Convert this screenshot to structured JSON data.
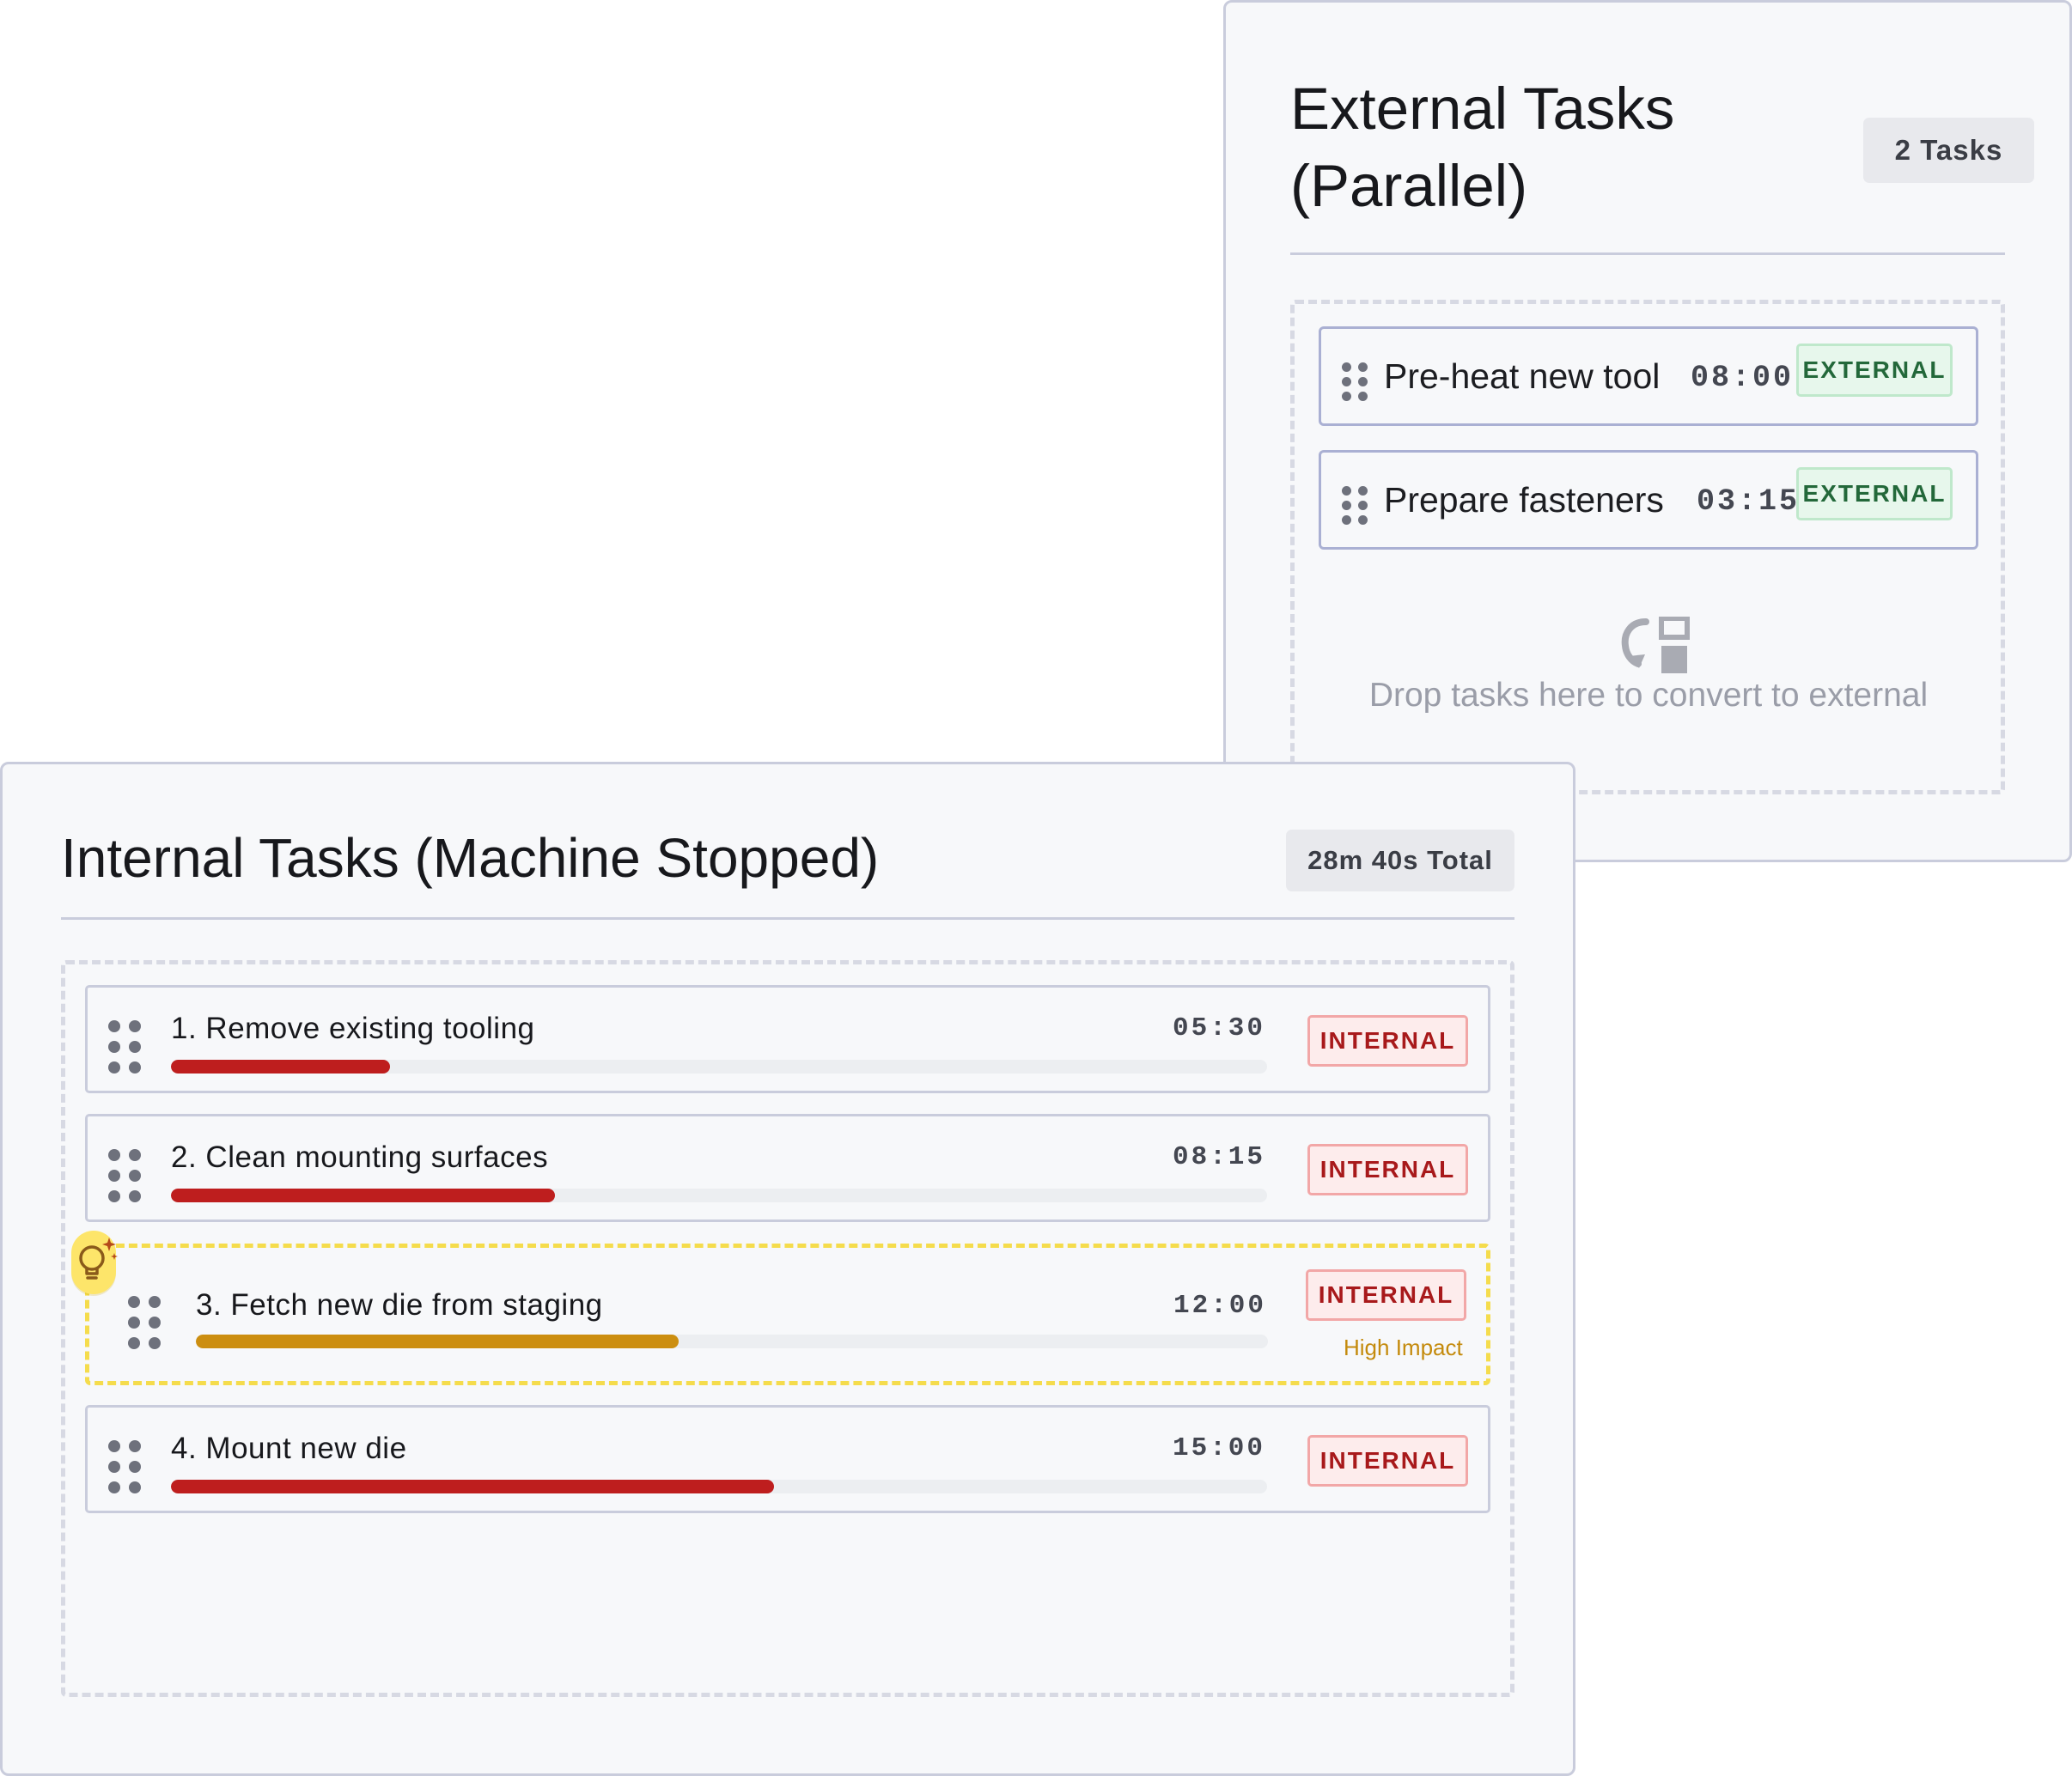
{
  "external": {
    "title_line1": "External Tasks",
    "title_line2": "(Parallel)",
    "count": "2 Tasks",
    "tasks": [
      {
        "title": "Pre-heat new tool",
        "time": "08:00",
        "tag": "EXTERNAL"
      },
      {
        "title": "Prepare fasteners",
        "time": "03:15",
        "tag": "EXTERNAL"
      }
    ],
    "drop_hint": "Drop tasks here to convert to external",
    "tag_color": "#23683a"
  },
  "internal": {
    "title": "Internal Tasks (Machine Stopped)",
    "total": "28m 40s Total",
    "tasks": [
      {
        "title": "1. Remove existing tooling",
        "time": "05:30",
        "tag": "INTERNAL",
        "progress": 0.2,
        "color": "#be1e1e"
      },
      {
        "title": "2. Clean mounting surfaces",
        "time": "08:15",
        "tag": "INTERNAL",
        "progress": 0.35,
        "color": "#be1e1e"
      },
      {
        "title": "3. Fetch new die from staging",
        "time": "12:00",
        "tag": "INTERNAL",
        "progress": 0.45,
        "color": "#cc8e10",
        "note": "High Impact",
        "highlighted": true
      },
      {
        "title": "4. Mount new die",
        "time": "15:00",
        "tag": "INTERNAL",
        "progress": 0.55,
        "color": "#be1e1e"
      }
    ],
    "tag_color": "#a8191b",
    "highlight_color": "#f5dc4c"
  },
  "icons": {
    "grip": "drag-handle-icon",
    "convert": "convert-to-external-icon",
    "suggestion": "lightbulb-sparkle-icon"
  }
}
